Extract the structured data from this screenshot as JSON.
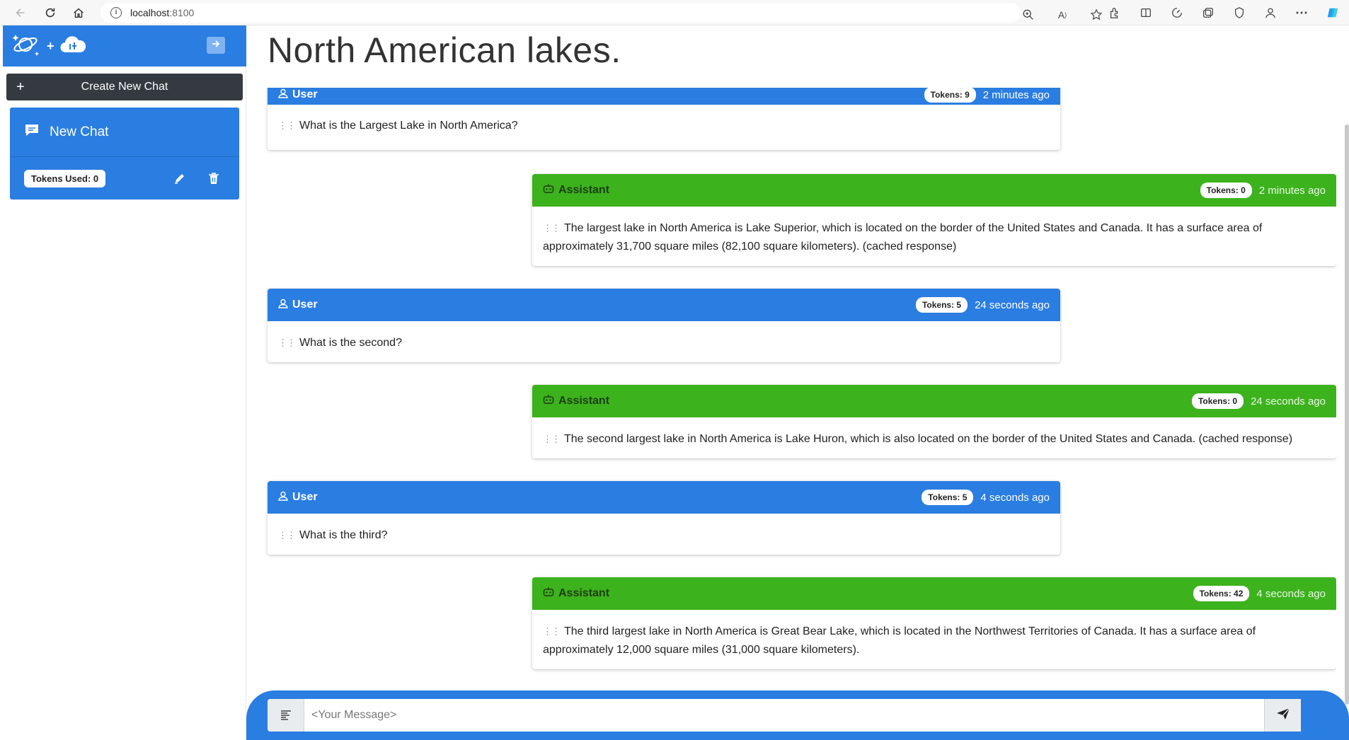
{
  "browser": {
    "url_host": "localhost",
    "url_port": ":8100"
  },
  "sidebar": {
    "create_label": "Create New Chat",
    "create_plus": "+",
    "chat": {
      "title": "New Chat",
      "tokens_label": "Tokens Used: 0"
    }
  },
  "main": {
    "title": "North American lakes."
  },
  "messages": [
    {
      "role": "User",
      "tokens": "Tokens: 9",
      "time": "2 minutes ago",
      "text": "What is the Largest Lake in North America?"
    },
    {
      "role": "Assistant",
      "tokens": "Tokens: 0",
      "time": "2 minutes ago",
      "text": "The largest lake in North America is Lake Superior, which is located on the border of the United States and Canada. It has a surface area of approximately 31,700 square miles (82,100 square kilometers). (cached response)"
    },
    {
      "role": "User",
      "tokens": "Tokens: 5",
      "time": "24 seconds ago",
      "text": "What is the second?"
    },
    {
      "role": "Assistant",
      "tokens": "Tokens: 0",
      "time": "24 seconds ago",
      "text": "The second largest lake in North America is Lake Huron, which is also located on the border of the United States and Canada. (cached response)"
    },
    {
      "role": "User",
      "tokens": "Tokens: 5",
      "time": "4 seconds ago",
      "text": "What is the third?"
    },
    {
      "role": "Assistant",
      "tokens": "Tokens: 42",
      "time": "4 seconds ago",
      "text": "The third largest lake in North America is Great Bear Lake, which is located in the Northwest Territories of Canada. It has a surface area of approximately 12,000 square miles (31,000 square kilometers)."
    }
  ],
  "input": {
    "placeholder": "<Your Message>"
  },
  "colors": {
    "user_header": "#2a7de1",
    "assistant_header": "#3cb21d",
    "sidebar_header": "#2a7de1",
    "create_button": "#343a40"
  }
}
